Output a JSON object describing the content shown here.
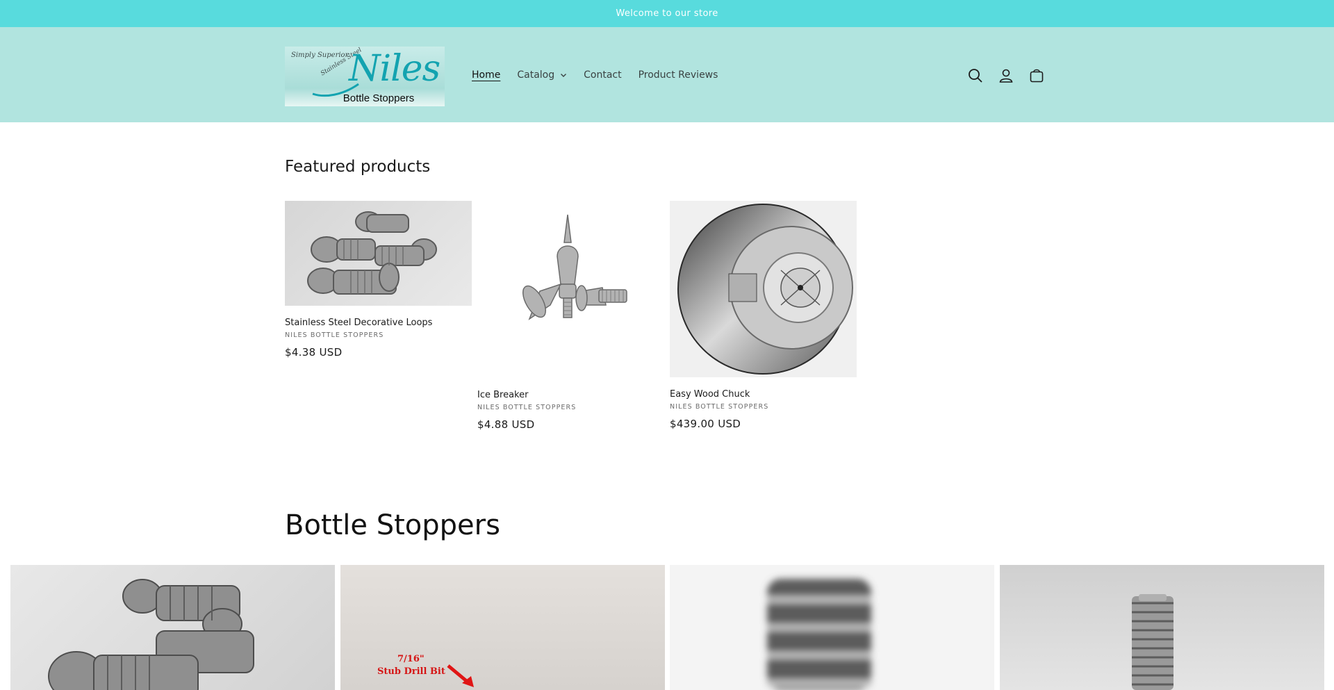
{
  "announcement": {
    "text": "Welcome to our store"
  },
  "logo": {
    "tagline": "Simply Superior",
    "tagline2": "Stainless Steel",
    "brand": "Niles",
    "subtitle": "Bottle Stoppers"
  },
  "nav": {
    "items": [
      {
        "label": "Home",
        "active": true
      },
      {
        "label": "Catalog",
        "has_dropdown": true
      },
      {
        "label": "Contact"
      },
      {
        "label": "Product Reviews"
      }
    ]
  },
  "header_icons": [
    "search-icon",
    "account-icon",
    "cart-icon"
  ],
  "featured": {
    "title": "Featured products",
    "products": [
      {
        "name": "Stainless Steel Decorative Loops",
        "vendor": "NILES BOTTLE STOPPERS",
        "price": "$4.38 USD",
        "image": "steel-loops-photo"
      },
      {
        "name": "Ice Breaker",
        "vendor": "NILES BOTTLE STOPPERS",
        "price": "$4.88 USD",
        "image": "ice-breaker-photo"
      },
      {
        "name": "Easy Wood Chuck",
        "vendor": "NILES BOTTLE STOPPERS",
        "price": "$439.00 USD",
        "image": "wood-chuck-photo"
      }
    ]
  },
  "collection": {
    "title": "Bottle Stoppers",
    "tiles": [
      {
        "image": "steel-loops-closeup"
      },
      {
        "image": "stub-drill-bit-photo",
        "overlay_line1": "7/16\"",
        "overlay_line2": "Stub Drill Bit"
      },
      {
        "image": "threaded-stud-blurred"
      },
      {
        "image": "threaded-stud-mount"
      }
    ]
  },
  "colors": {
    "announcement_bg": "#58dbdd",
    "header_bg": "#b1e4df",
    "brand": "#13a3b0"
  }
}
